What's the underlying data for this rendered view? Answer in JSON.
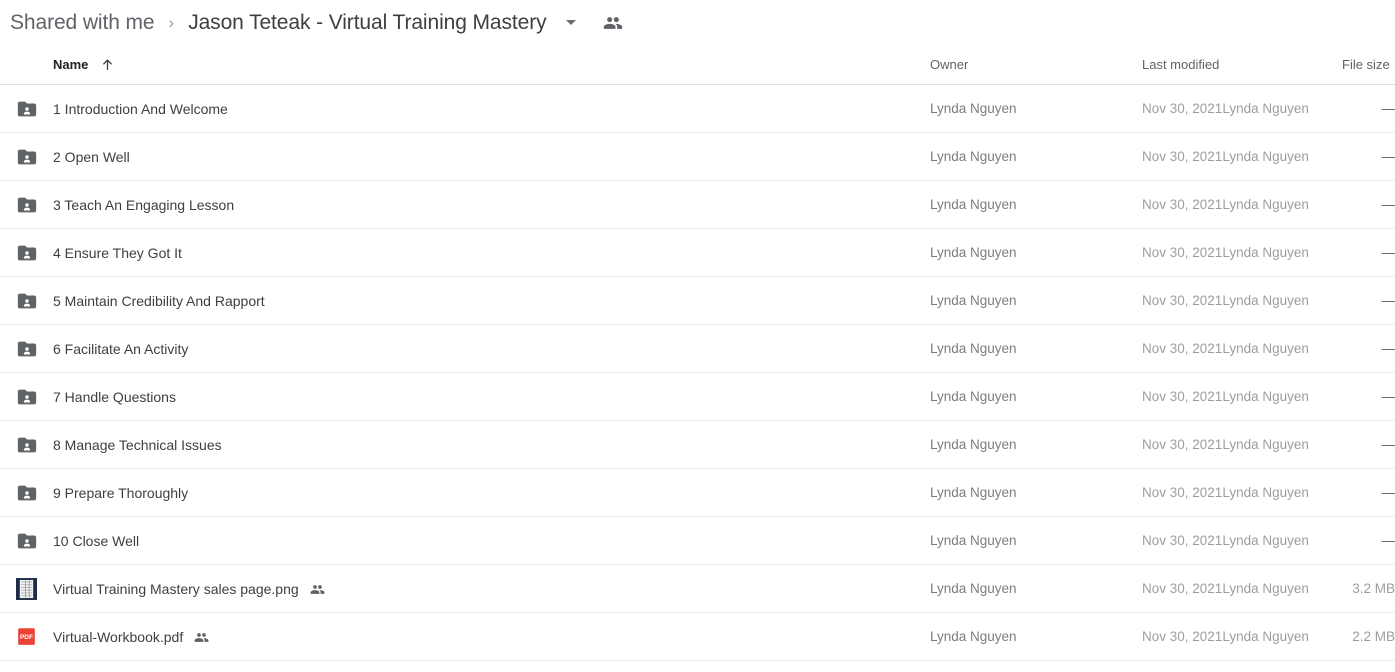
{
  "breadcrumb": {
    "root_label": "Shared with me",
    "separator": "›",
    "current_label": "Jason Teteak - Virtual Training Mastery",
    "dropdown_icon": "chevron-down-icon",
    "people_icon": "people-shared-icon"
  },
  "columns": {
    "name": "Name",
    "owner": "Owner",
    "last_modified": "Last modified",
    "file_size": "File size",
    "sort_icon": "arrow-up-icon",
    "sort_direction": "ascending"
  },
  "rows": [
    {
      "icon": "shared-folder-icon",
      "name": "1 Introduction And Welcome",
      "shared": false,
      "owner": "Lynda Nguyen",
      "modified_date": "Nov 30, 2021",
      "modified_by": "Lynda Nguyen",
      "size": "—"
    },
    {
      "icon": "shared-folder-icon",
      "name": "2 Open Well",
      "shared": false,
      "owner": "Lynda Nguyen",
      "modified_date": "Nov 30, 2021",
      "modified_by": "Lynda Nguyen",
      "size": "—"
    },
    {
      "icon": "shared-folder-icon",
      "name": "3 Teach An Engaging Lesson",
      "shared": false,
      "owner": "Lynda Nguyen",
      "modified_date": "Nov 30, 2021",
      "modified_by": "Lynda Nguyen",
      "size": "—"
    },
    {
      "icon": "shared-folder-icon",
      "name": "4 Ensure They Got It",
      "shared": false,
      "owner": "Lynda Nguyen",
      "modified_date": "Nov 30, 2021",
      "modified_by": "Lynda Nguyen",
      "size": "—"
    },
    {
      "icon": "shared-folder-icon",
      "name": "5 Maintain Credibility And Rapport",
      "shared": false,
      "owner": "Lynda Nguyen",
      "modified_date": "Nov 30, 2021",
      "modified_by": "Lynda Nguyen",
      "size": "—"
    },
    {
      "icon": "shared-folder-icon",
      "name": "6 Facilitate An Activity",
      "shared": false,
      "owner": "Lynda Nguyen",
      "modified_date": "Nov 30, 2021",
      "modified_by": "Lynda Nguyen",
      "size": "—"
    },
    {
      "icon": "shared-folder-icon",
      "name": "7 Handle Questions",
      "shared": false,
      "owner": "Lynda Nguyen",
      "modified_date": "Nov 30, 2021",
      "modified_by": "Lynda Nguyen",
      "size": "—"
    },
    {
      "icon": "shared-folder-icon",
      "name": "8 Manage Technical Issues",
      "shared": false,
      "owner": "Lynda Nguyen",
      "modified_date": "Nov 30, 2021",
      "modified_by": "Lynda Nguyen",
      "size": "—"
    },
    {
      "icon": "shared-folder-icon",
      "name": "9 Prepare Thoroughly",
      "shared": false,
      "owner": "Lynda Nguyen",
      "modified_date": "Nov 30, 2021",
      "modified_by": "Lynda Nguyen",
      "size": "—"
    },
    {
      "icon": "shared-folder-icon",
      "name": "10 Close Well",
      "shared": false,
      "owner": "Lynda Nguyen",
      "modified_date": "Nov 30, 2021",
      "modified_by": "Lynda Nguyen",
      "size": "—"
    },
    {
      "icon": "image-thumbnail-icon",
      "name": "Virtual Training Mastery sales page.png",
      "shared": true,
      "owner": "Lynda Nguyen",
      "modified_date": "Nov 30, 2021",
      "modified_by": "Lynda Nguyen",
      "size": "3.2 MB"
    },
    {
      "icon": "pdf-file-icon",
      "name": "Virtual-Workbook.pdf",
      "shared": true,
      "owner": "Lynda Nguyen",
      "modified_date": "Nov 30, 2021",
      "modified_by": "Lynda Nguyen",
      "size": "2.2 MB"
    }
  ],
  "colors": {
    "folder_icon": "#5f6368",
    "pdf_icon": "#ea4335",
    "image_icon_bg": "#1d2b46",
    "text_primary": "#3c4043",
    "text_secondary": "#5f6368",
    "text_muted": "#9b9ea1",
    "row_divider": "#e8eaed"
  }
}
